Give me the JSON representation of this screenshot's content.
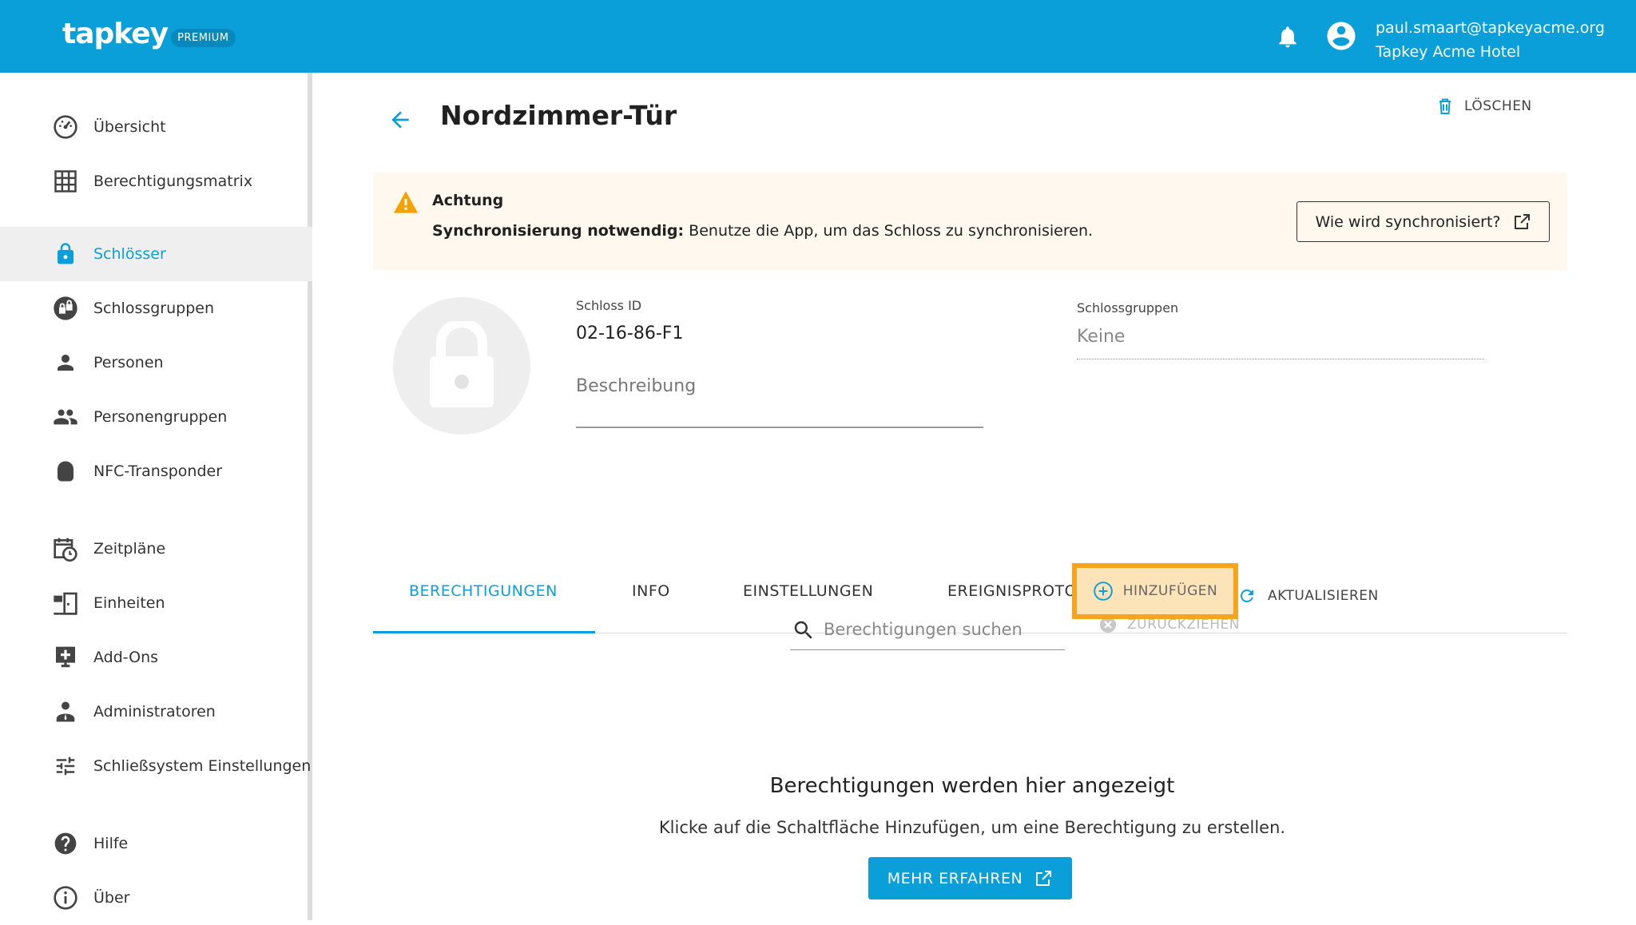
{
  "header": {
    "logo": "tapkey",
    "badge": "PREMIUM",
    "user_email": "paul.smaart@tapkeyacme.org",
    "user_org": "Tapkey Acme Hotel"
  },
  "sidebar": {
    "items": [
      {
        "label": "Übersicht",
        "icon": "dashboard-icon"
      },
      {
        "label": "Berechtigungsmatrix",
        "icon": "grid-icon"
      },
      {
        "label": "Schlösser",
        "icon": "lock-icon",
        "active": true
      },
      {
        "label": "Schlossgruppen",
        "icon": "lock-group-icon"
      },
      {
        "label": "Personen",
        "icon": "person-icon"
      },
      {
        "label": "Personengruppen",
        "icon": "people-icon"
      },
      {
        "label": "NFC-Transponder",
        "icon": "transponder-icon"
      },
      {
        "label": "Zeitpläne",
        "icon": "schedule-icon"
      },
      {
        "label": "Einheiten",
        "icon": "units-icon"
      },
      {
        "label": "Add-Ons",
        "icon": "addons-icon"
      },
      {
        "label": "Administratoren",
        "icon": "admin-icon"
      },
      {
        "label": "Schließsystem Einstellungen",
        "icon": "tune-icon"
      },
      {
        "label": "Hilfe",
        "icon": "help-icon"
      },
      {
        "label": "Über",
        "icon": "info-icon"
      }
    ]
  },
  "page": {
    "title": "Nordzimmer-Tür",
    "delete_label": "LÖSCHEN"
  },
  "alert": {
    "heading": "Achtung",
    "bold": "Synchronisierung notwendig:",
    "text": " Benutze die App, um das Schloss zu synchronisieren.",
    "button": "Wie wird synchronisiert?"
  },
  "details": {
    "lock_id_label": "Schloss ID",
    "lock_id_value": "02-16-86-F1",
    "description_placeholder": "Beschreibung",
    "groups_label": "Schlossgruppen",
    "groups_value": "Keine"
  },
  "tabs": [
    {
      "label": "BERECHTIGUNGEN",
      "active": true
    },
    {
      "label": "INFO"
    },
    {
      "label": "EINSTELLUNGEN"
    },
    {
      "label": "EREIGNISPROTOKOLLE"
    }
  ],
  "toolbar": {
    "add_label": "HINZUFÜGEN",
    "refresh_label": "AKTUALISIEREN",
    "revoke_label": "ZURÜCKZIEHEN",
    "search_placeholder": "Berechtigungen suchen"
  },
  "empty": {
    "title": "Berechtigungen werden hier angezeigt",
    "subtitle": "Klicke auf die Schaltfläche Hinzufügen, um eine Berechtigung zu erstellen.",
    "button": "MEHR ERFAHREN"
  },
  "colors": {
    "primary": "#0a9fd9",
    "highlight": "#f7a41d",
    "alert_bg": "#fff8ee",
    "warning": "#f4a100"
  }
}
